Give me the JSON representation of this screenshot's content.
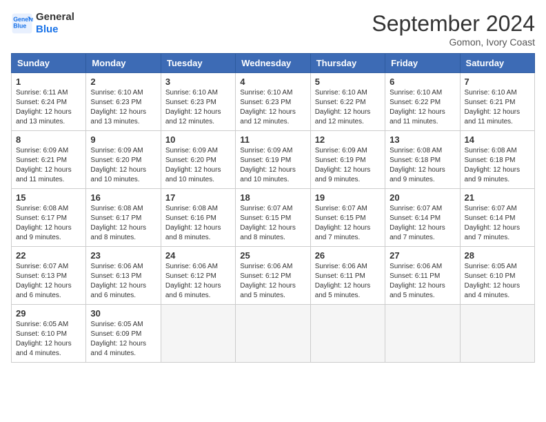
{
  "header": {
    "logo_line1": "General",
    "logo_line2": "Blue",
    "month_title": "September 2024",
    "location": "Gomon, Ivory Coast"
  },
  "columns": [
    "Sunday",
    "Monday",
    "Tuesday",
    "Wednesday",
    "Thursday",
    "Friday",
    "Saturday"
  ],
  "weeks": [
    [
      {
        "day": "1",
        "lines": [
          "Sunrise: 6:11 AM",
          "Sunset: 6:24 PM",
          "Daylight: 12 hours",
          "and 13 minutes."
        ]
      },
      {
        "day": "2",
        "lines": [
          "Sunrise: 6:10 AM",
          "Sunset: 6:23 PM",
          "Daylight: 12 hours",
          "and 13 minutes."
        ]
      },
      {
        "day": "3",
        "lines": [
          "Sunrise: 6:10 AM",
          "Sunset: 6:23 PM",
          "Daylight: 12 hours",
          "and 12 minutes."
        ]
      },
      {
        "day": "4",
        "lines": [
          "Sunrise: 6:10 AM",
          "Sunset: 6:23 PM",
          "Daylight: 12 hours",
          "and 12 minutes."
        ]
      },
      {
        "day": "5",
        "lines": [
          "Sunrise: 6:10 AM",
          "Sunset: 6:22 PM",
          "Daylight: 12 hours",
          "and 12 minutes."
        ]
      },
      {
        "day": "6",
        "lines": [
          "Sunrise: 6:10 AM",
          "Sunset: 6:22 PM",
          "Daylight: 12 hours",
          "and 11 minutes."
        ]
      },
      {
        "day": "7",
        "lines": [
          "Sunrise: 6:10 AM",
          "Sunset: 6:21 PM",
          "Daylight: 12 hours",
          "and 11 minutes."
        ]
      }
    ],
    [
      {
        "day": "8",
        "lines": [
          "Sunrise: 6:09 AM",
          "Sunset: 6:21 PM",
          "Daylight: 12 hours",
          "and 11 minutes."
        ]
      },
      {
        "day": "9",
        "lines": [
          "Sunrise: 6:09 AM",
          "Sunset: 6:20 PM",
          "Daylight: 12 hours",
          "and 10 minutes."
        ]
      },
      {
        "day": "10",
        "lines": [
          "Sunrise: 6:09 AM",
          "Sunset: 6:20 PM",
          "Daylight: 12 hours",
          "and 10 minutes."
        ]
      },
      {
        "day": "11",
        "lines": [
          "Sunrise: 6:09 AM",
          "Sunset: 6:19 PM",
          "Daylight: 12 hours",
          "and 10 minutes."
        ]
      },
      {
        "day": "12",
        "lines": [
          "Sunrise: 6:09 AM",
          "Sunset: 6:19 PM",
          "Daylight: 12 hours",
          "and 9 minutes."
        ]
      },
      {
        "day": "13",
        "lines": [
          "Sunrise: 6:08 AM",
          "Sunset: 6:18 PM",
          "Daylight: 12 hours",
          "and 9 minutes."
        ]
      },
      {
        "day": "14",
        "lines": [
          "Sunrise: 6:08 AM",
          "Sunset: 6:18 PM",
          "Daylight: 12 hours",
          "and 9 minutes."
        ]
      }
    ],
    [
      {
        "day": "15",
        "lines": [
          "Sunrise: 6:08 AM",
          "Sunset: 6:17 PM",
          "Daylight: 12 hours",
          "and 9 minutes."
        ]
      },
      {
        "day": "16",
        "lines": [
          "Sunrise: 6:08 AM",
          "Sunset: 6:17 PM",
          "Daylight: 12 hours",
          "and 8 minutes."
        ]
      },
      {
        "day": "17",
        "lines": [
          "Sunrise: 6:08 AM",
          "Sunset: 6:16 PM",
          "Daylight: 12 hours",
          "and 8 minutes."
        ]
      },
      {
        "day": "18",
        "lines": [
          "Sunrise: 6:07 AM",
          "Sunset: 6:15 PM",
          "Daylight: 12 hours",
          "and 8 minutes."
        ]
      },
      {
        "day": "19",
        "lines": [
          "Sunrise: 6:07 AM",
          "Sunset: 6:15 PM",
          "Daylight: 12 hours",
          "and 7 minutes."
        ]
      },
      {
        "day": "20",
        "lines": [
          "Sunrise: 6:07 AM",
          "Sunset: 6:14 PM",
          "Daylight: 12 hours",
          "and 7 minutes."
        ]
      },
      {
        "day": "21",
        "lines": [
          "Sunrise: 6:07 AM",
          "Sunset: 6:14 PM",
          "Daylight: 12 hours",
          "and 7 minutes."
        ]
      }
    ],
    [
      {
        "day": "22",
        "lines": [
          "Sunrise: 6:07 AM",
          "Sunset: 6:13 PM",
          "Daylight: 12 hours",
          "and 6 minutes."
        ]
      },
      {
        "day": "23",
        "lines": [
          "Sunrise: 6:06 AM",
          "Sunset: 6:13 PM",
          "Daylight: 12 hours",
          "and 6 minutes."
        ]
      },
      {
        "day": "24",
        "lines": [
          "Sunrise: 6:06 AM",
          "Sunset: 6:12 PM",
          "Daylight: 12 hours",
          "and 6 minutes."
        ]
      },
      {
        "day": "25",
        "lines": [
          "Sunrise: 6:06 AM",
          "Sunset: 6:12 PM",
          "Daylight: 12 hours",
          "and 5 minutes."
        ]
      },
      {
        "day": "26",
        "lines": [
          "Sunrise: 6:06 AM",
          "Sunset: 6:11 PM",
          "Daylight: 12 hours",
          "and 5 minutes."
        ]
      },
      {
        "day": "27",
        "lines": [
          "Sunrise: 6:06 AM",
          "Sunset: 6:11 PM",
          "Daylight: 12 hours",
          "and 5 minutes."
        ]
      },
      {
        "day": "28",
        "lines": [
          "Sunrise: 6:05 AM",
          "Sunset: 6:10 PM",
          "Daylight: 12 hours",
          "and 4 minutes."
        ]
      }
    ],
    [
      {
        "day": "29",
        "lines": [
          "Sunrise: 6:05 AM",
          "Sunset: 6:10 PM",
          "Daylight: 12 hours",
          "and 4 minutes."
        ]
      },
      {
        "day": "30",
        "lines": [
          "Sunrise: 6:05 AM",
          "Sunset: 6:09 PM",
          "Daylight: 12 hours",
          "and 4 minutes."
        ]
      },
      {
        "day": "",
        "lines": []
      },
      {
        "day": "",
        "lines": []
      },
      {
        "day": "",
        "lines": []
      },
      {
        "day": "",
        "lines": []
      },
      {
        "day": "",
        "lines": []
      }
    ]
  ]
}
